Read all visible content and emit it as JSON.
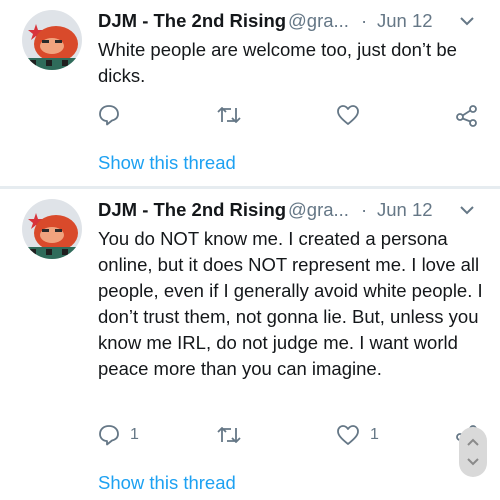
{
  "tweets": [
    {
      "author_name": "DJM - The 2nd Rising",
      "handle": "@gra...",
      "separator": "·",
      "date": "Jun 12",
      "text": "White people are welcome too, just don’t be dicks.",
      "reply_count": "",
      "like_count": "",
      "show_thread": "Show this thread"
    },
    {
      "author_name": "DJM - The 2nd Rising",
      "handle": "@gra...",
      "separator": "·",
      "date": "Jun 12",
      "text": "You do NOT know me. I created a persona online, but it does NOT represent me. I love all people, even if I generally avoid white people. I don’t trust them, not gonna lie. But, unless you know me IRL, do not judge me. I want world peace more than you can imagine.",
      "reply_count": "1",
      "like_count": "1",
      "show_thread": "Show this thread"
    }
  ],
  "colors": {
    "link": "#1da1f2",
    "secondary_text": "#657786",
    "primary_text": "#14171a",
    "divider": "#e6ecf0",
    "icon": "#657786"
  },
  "icons": [
    "reply-icon",
    "retweet-icon",
    "like-icon",
    "share-icon",
    "chevron-down-icon"
  ]
}
